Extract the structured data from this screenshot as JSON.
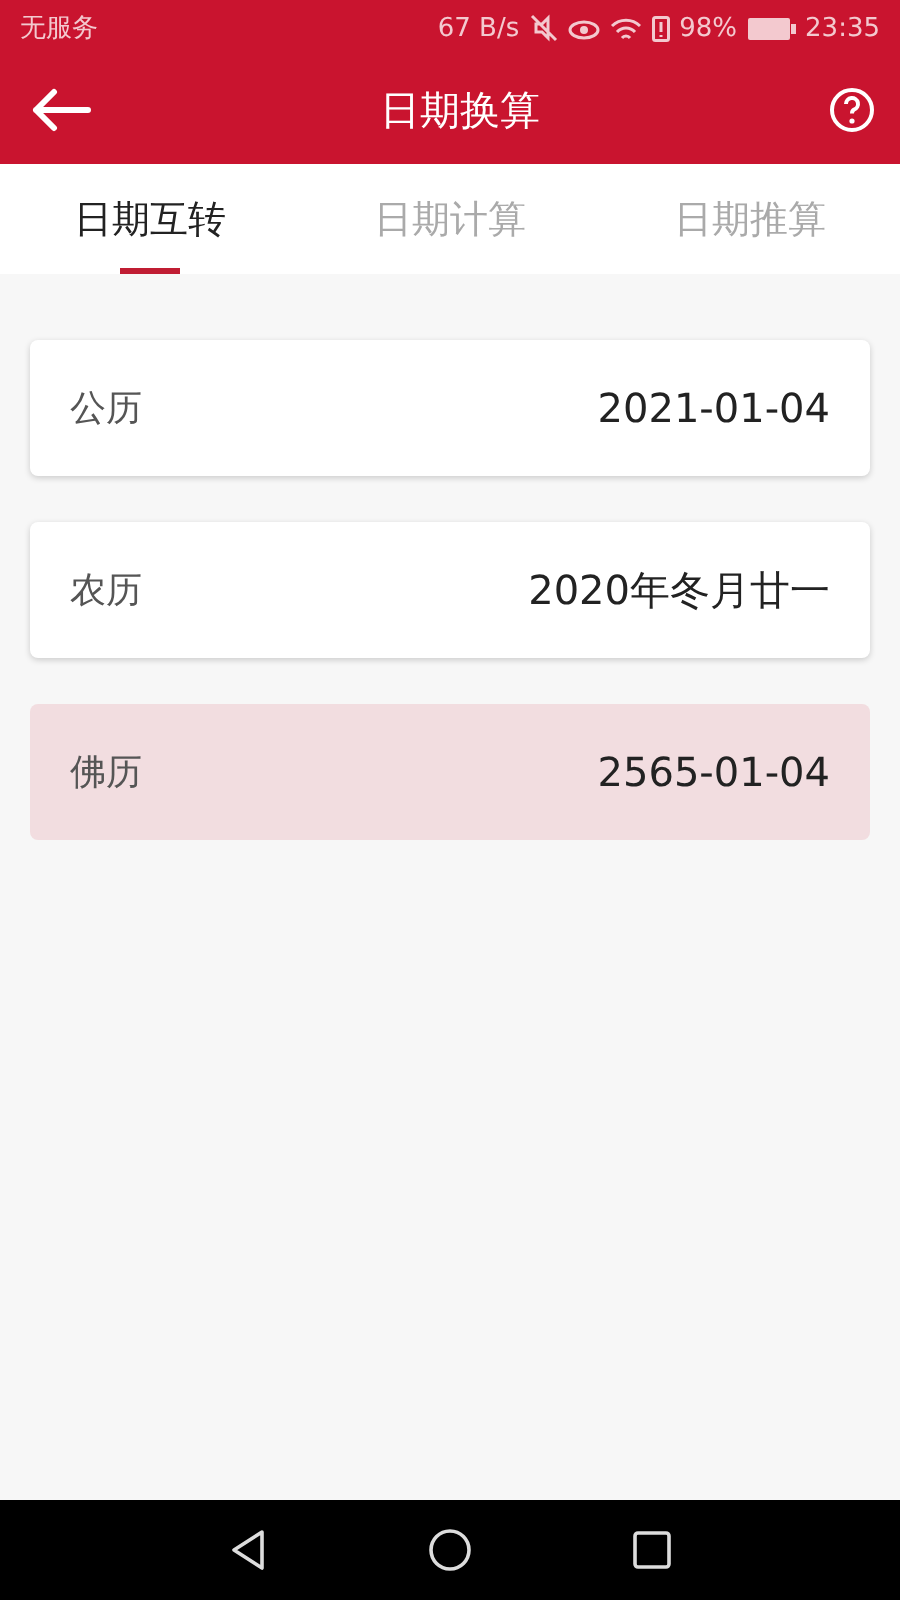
{
  "status_bar": {
    "carrier": "无服务",
    "speed": "67 B/s",
    "battery": "98%",
    "time": "23:35"
  },
  "header": {
    "title": "日期换算"
  },
  "tabs": [
    {
      "label": "日期互转",
      "selected": true
    },
    {
      "label": "日期计算",
      "selected": false
    },
    {
      "label": "日期推算",
      "selected": false
    }
  ],
  "rows": [
    {
      "label": "公历",
      "value": "2021-01-04",
      "selected": false
    },
    {
      "label": "农历",
      "value": "2020年冬月廿一",
      "selected": false
    },
    {
      "label": "佛历",
      "value": "2565-01-04",
      "selected": true
    }
  ]
}
